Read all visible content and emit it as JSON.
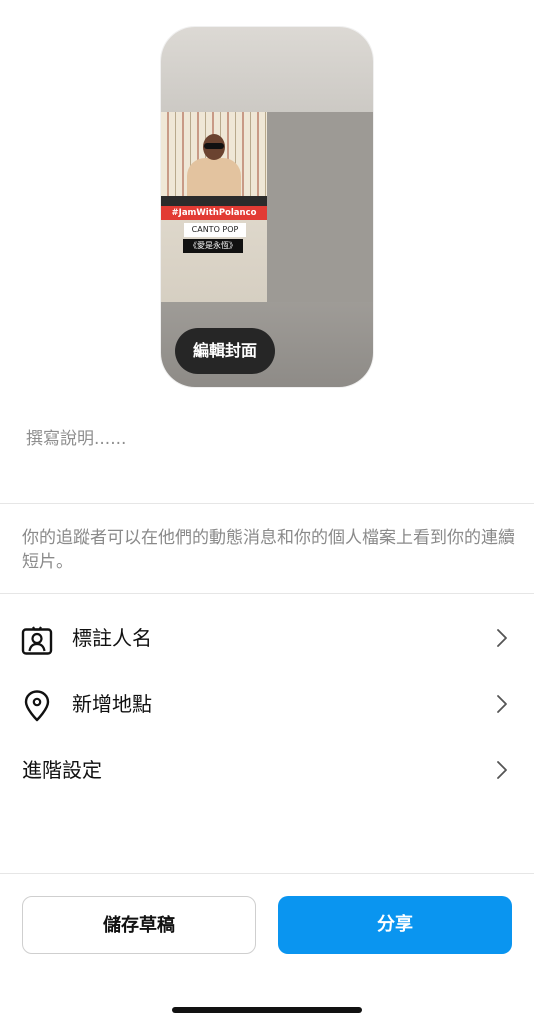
{
  "preview": {
    "hashtag_banner": "#JamWithPolanco",
    "genre_label": "CANTO POP",
    "song_label": "《愛是永恆》",
    "edit_cover_label": "編輯封面"
  },
  "caption": {
    "placeholder": "撰寫說明......"
  },
  "info_text": "你的追蹤者可以在他們的動態消息和你的個人檔案上看到你的連續短片。",
  "rows": [
    {
      "label": "標註人名",
      "icon": "tag-people-icon"
    },
    {
      "label": "新增地點",
      "icon": "location-pin-icon"
    },
    {
      "label": "進階設定"
    }
  ],
  "buttons": {
    "save_draft": "儲存草稿",
    "share": "分享"
  },
  "colors": {
    "share_button": "#0a95f0",
    "edit_cover_button": "#262626"
  }
}
